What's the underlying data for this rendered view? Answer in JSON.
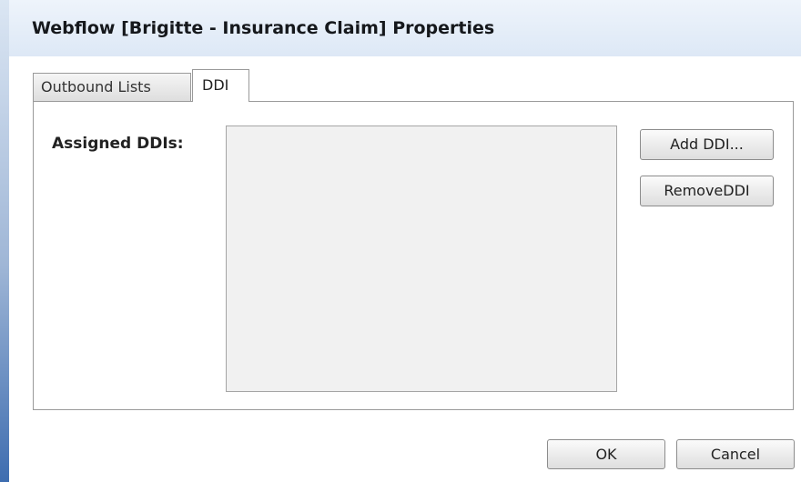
{
  "window": {
    "title": "Webflow [Brigitte - Insurance Claim] Properties"
  },
  "tabs": [
    {
      "label": "Outbound Lists",
      "active": false
    },
    {
      "label": "DDI",
      "active": true
    }
  ],
  "ddi_panel": {
    "assigned_label": "Assigned DDIs:",
    "assigned_items": [],
    "add_button": "Add DDI...",
    "remove_button": "RemoveDDI"
  },
  "footer": {
    "ok_button": "OK",
    "cancel_button": "Cancel"
  },
  "colors": {
    "title_bar": "#dde8f6",
    "list_background": "#f1f1f1",
    "side_strip": "#3e6db0"
  }
}
